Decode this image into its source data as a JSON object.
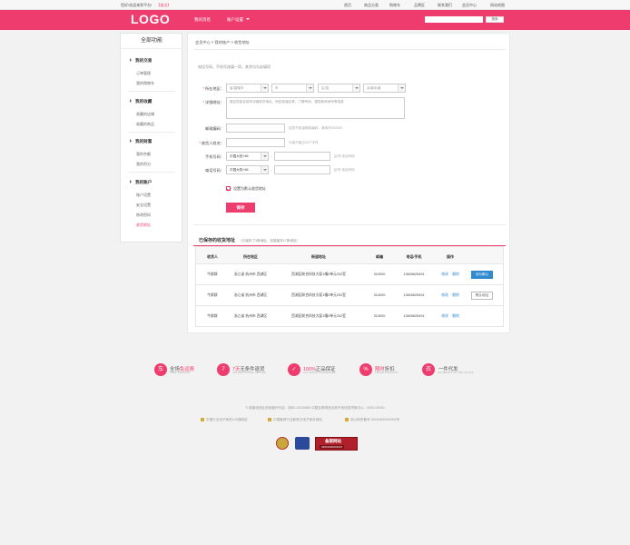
{
  "topbar": {
    "welcome": "您好!欢迎来到平台!",
    "login": "【退出】",
    "links": [
      "首页",
      "商品分类",
      "购物车",
      "品牌区",
      "联系我们",
      "会员中心",
      "网站地图"
    ]
  },
  "header": {
    "logo": "LOGO",
    "nav": [
      "我的消息",
      "账户设置"
    ],
    "search_placeholder": "",
    "search_btn": "搜索"
  },
  "sidebar": {
    "title": "全部功能",
    "sections": [
      {
        "title": "我的交易",
        "items": [
          "订单管理",
          "我的购物车"
        ]
      },
      {
        "title": "我的收藏",
        "items": [
          "收藏的店铺",
          "收藏的商品"
        ]
      },
      {
        "title": "我的财富",
        "items": [
          "我的余额",
          "我的积分"
        ]
      },
      {
        "title": "我的账户",
        "items": [
          "账户设置",
          "安全设置",
          "修改密码",
          "收货地址"
        ]
      }
    ]
  },
  "main": {
    "breadcrumb": [
      "会员中心",
      "我的账户",
      "收货地址"
    ],
    "tip": "电话号码、手机号选填一项，其余均为必填项",
    "form": {
      "region_label": "所在地区：",
      "region_selects": [
        "省/直辖市",
        "市",
        "区/县",
        "乡镇/街道"
      ],
      "detail_label": "详细地址：",
      "detail_placeholder": "建议您如实填写详细收货地址，例如街道名称，门牌号码，楼层和房间号等信息",
      "zip_label": "邮政编码：",
      "zip_hint": "如您不知道邮政编码，请填写000000",
      "name_label": "收货人姓名：",
      "name_hint": "长度不超过25个字符",
      "mobile_label": "手机号码：",
      "mobile_prefix": "中国大陆+86",
      "mobile_hint": "区号-电话号码",
      "phone_label": "电话号码：",
      "phone_prefix": "中国大陆+86",
      "phone_hint": "区号-电话号码",
      "default_check": "设置为默认收货地址",
      "save": "保存"
    },
    "saved": {
      "title": "已保存的收货地址",
      "subtitle": "（已保存了3条地址，还能保存17条地址）",
      "headers": [
        "收货人",
        "所在地区",
        "街道地址",
        "邮编",
        "电话/手机",
        "操作"
      ],
      "rows": [
        {
          "name": "牛群群",
          "region": "浙江省  杭州市  西湖区",
          "street": "西湖区联合科技大厦1幢2单元202室",
          "zip": "310000",
          "phone": "13600625491",
          "edit": "修改",
          "del": "删除",
          "action": "设为默认"
        },
        {
          "name": "牛群群",
          "region": "浙江省  杭州市  西湖区",
          "street": "西湖区联合科技大厦1幢2单元202室",
          "zip": "310000",
          "phone": "13600625491",
          "edit": "修改",
          "del": "删除",
          "action": "默认地址"
        },
        {
          "name": "牛群群",
          "region": "浙江省  杭州市  西湖区",
          "street": "西湖区联合科技大厦1幢2单元202室",
          "zip": "310000",
          "phone": "13600625491",
          "edit": "修改",
          "del": "删除",
          "action": ""
        }
      ]
    }
  },
  "footer": {
    "features": [
      {
        "icon": "车",
        "pre": "全场",
        "hl": "免运费",
        "post": "",
        "en": "FREE SHIPPING"
      },
      {
        "icon": "7",
        "pre": "",
        "hl": "7天",
        "post": "无条件退货",
        "en": "UNCONDITIONAL RETURN"
      },
      {
        "icon": "✓",
        "pre": "",
        "hl": "100%",
        "post": "正品保证",
        "en": "AUTHENTIC GUARANTEE"
      },
      {
        "icon": "%",
        "pre": "",
        "hl": "限时",
        "post": "折扣",
        "en": "TRADE DISCOUNT"
      },
      {
        "icon": "衣",
        "pre": "",
        "hl": "",
        "post": "一件代发",
        "en": "ON BEHALF OF THE GOODS"
      }
    ],
    "line1": "© 增值电信业务经营许可证：浙B2-20110860    中国互联网违法和不良信息举报中心：0000-00000",
    "line2": [
      "中国行业电子商务100强网站",
      "中国最具行业影响力电子商务网站",
      "浙公网安备号 33010600000000号"
    ],
    "badge_title": "备案网站",
    "badge_sub": "33010000001097"
  },
  "colors": {
    "accent": "#ef3c6e",
    "link": "#2f8ad0"
  }
}
